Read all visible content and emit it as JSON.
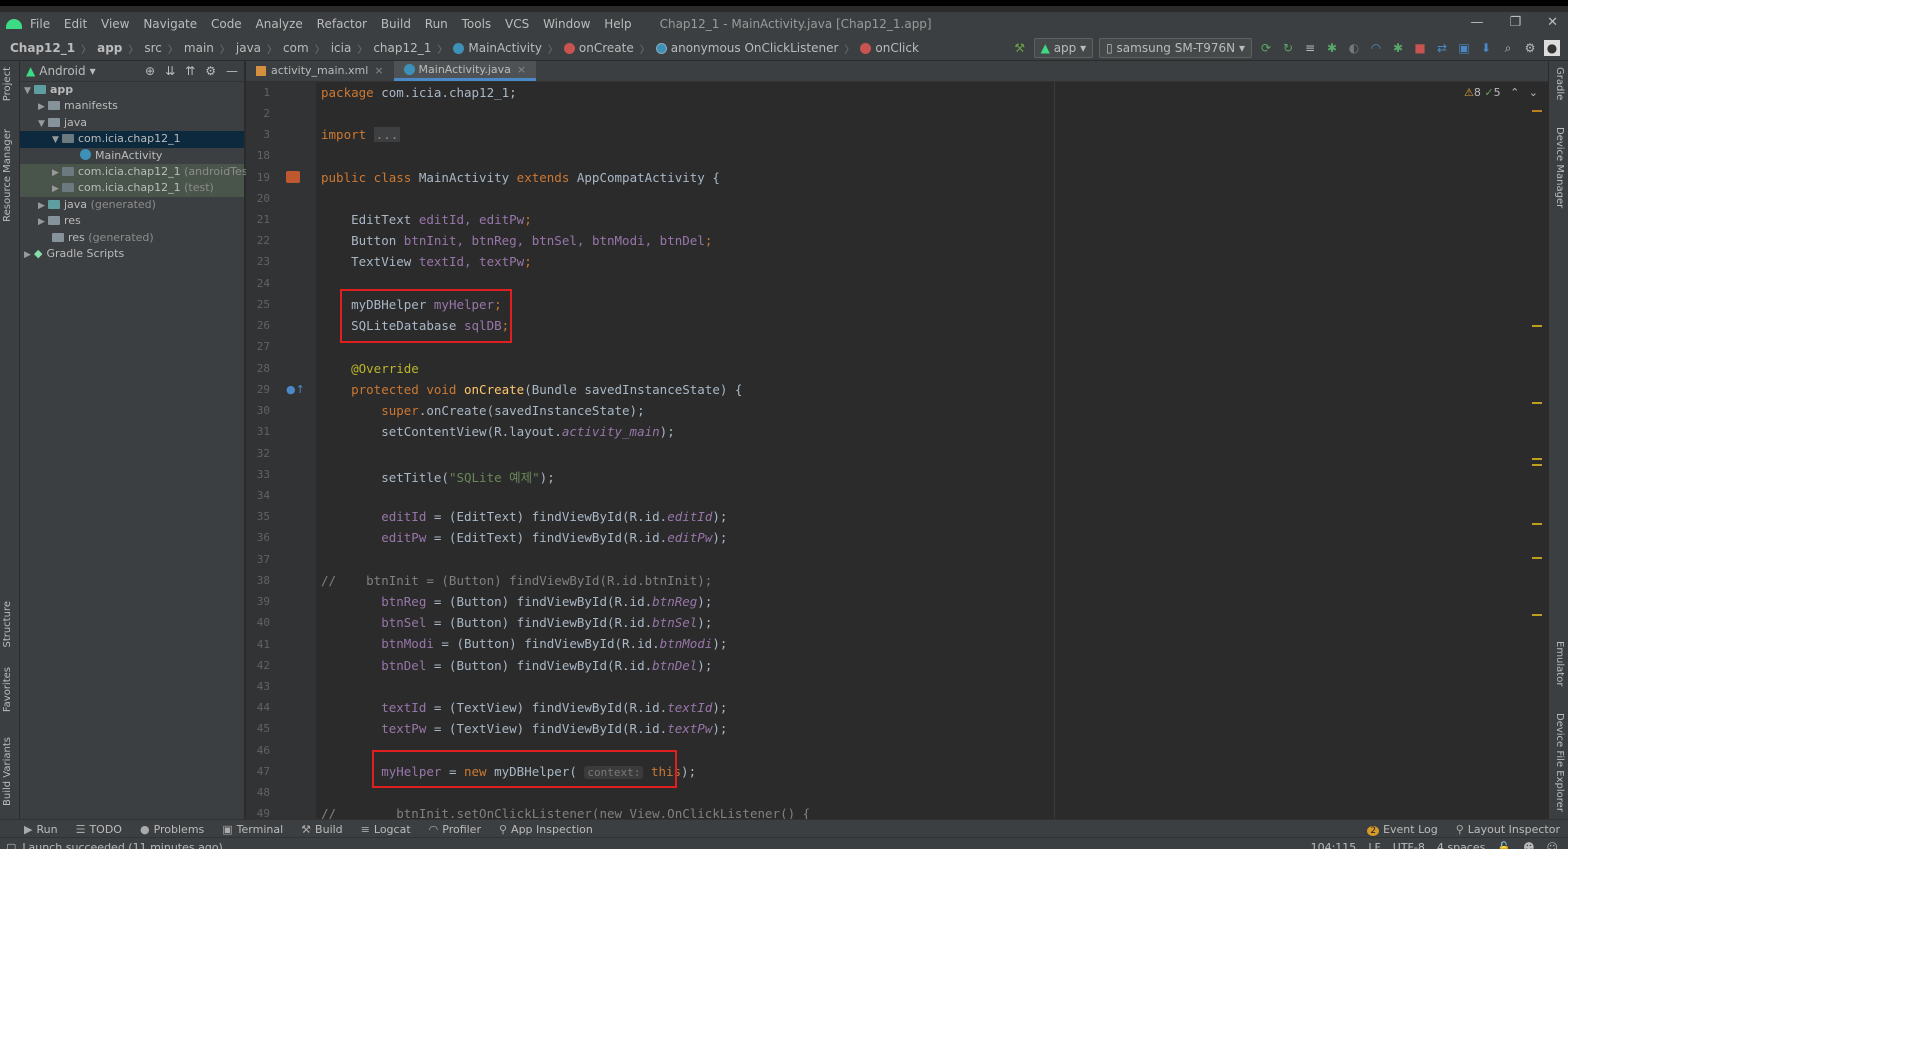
{
  "window": {
    "title": "Chap12_1 - MainActivity.java [Chap12_1.app]",
    "menu": [
      "File",
      "Edit",
      "View",
      "Navigate",
      "Code",
      "Analyze",
      "Refactor",
      "Build",
      "Run",
      "Tools",
      "VCS",
      "Window",
      "Help"
    ]
  },
  "breadcrumb": [
    "Chap12_1",
    "app",
    "src",
    "main",
    "java",
    "com",
    "icia",
    "chap12_1",
    "MainActivity",
    "onCreate",
    "anonymous OnClickListener",
    "onClick"
  ],
  "toolbar": {
    "run_config": "app",
    "device": "samsung SM-T976N"
  },
  "project_pane": {
    "view": "Android",
    "tree": {
      "app": "app",
      "manifests": "manifests",
      "java": "java",
      "pkg_main": "com.icia.chap12_1",
      "main_activity": "MainActivity",
      "pkg_android_test": "com.icia.chap12_1",
      "android_test_suffix": "(androidTest)",
      "pkg_test": "com.icia.chap12_1",
      "test_suffix": "(test)",
      "java_generated": "java",
      "java_generated_suffix": "(generated)",
      "res": "res",
      "res_generated": "res",
      "res_generated_suffix": "(generated)",
      "gradle_scripts": "Gradle Scripts"
    }
  },
  "left_stripe": [
    "Project",
    "Resource Manager",
    "Structure",
    "Favorites",
    "Build Variants"
  ],
  "right_stripe": [
    "Gradle",
    "Device Manager",
    "Emulator",
    "Device File Explorer"
  ],
  "editor_tabs": [
    {
      "label": "activity_main.xml",
      "active": false
    },
    {
      "label": "MainActivity.java",
      "active": true
    }
  ],
  "inspections": {
    "warnings": "8",
    "weak_warnings": "5"
  },
  "code": {
    "line_numbers": [
      "1",
      "2",
      "3",
      "18",
      "19",
      "20",
      "21",
      "22",
      "23",
      "24",
      "25",
      "26",
      "27",
      "28",
      "29",
      "30",
      "31",
      "32",
      "33",
      "34",
      "35",
      "36",
      "37",
      "38",
      "39",
      "40",
      "41",
      "42",
      "43",
      "44",
      "45",
      "46",
      "47",
      "48",
      "49"
    ],
    "l1_pkg": "package",
    "l1_name": " com.icia.chap12_1;",
    "l3_import": "import",
    "l3_dots": "...",
    "l19_public": "public class",
    "l19_name": " MainActivity ",
    "l19_extends": "extends",
    "l19_rest": " AppCompatActivity {",
    "l21_type": "    EditText ",
    "l21_vars": "editId, editPw",
    "l22_type": "    Button ",
    "l22_vars": "btnInit, btnReg, btnSel, btnModi, btnDel",
    "l23_type": "    TextView ",
    "l23_vars": "textId, textPw",
    "l25_type": "    myDBHelper ",
    "l25_var": "myHelper",
    "l26_type": "    SQLiteDatabase ",
    "l26_var": "sqlDB",
    "l28_ann": "    @Override",
    "l29_kw": "    protected void ",
    "l29_mth": "onCreate",
    "l29_rest": "(Bundle savedInstanceState) {",
    "l30_super": "        super",
    "l30_rest": ".onCreate(savedInstanceState);",
    "l31_a": "        setContentView(R.layout.",
    "l31_b": "activity_main",
    "l31_c": ");",
    "l33_a": "        setTitle(",
    "l33_str": "\"SQLite 예제\"",
    "l33_c": ");",
    "l35_var": "        editId",
    "l35_a": " = (EditText) findViewById(R.id.",
    "l35_id": "editId",
    "l36_var": "        editPw",
    "l36_a": " = (EditText) findViewById(R.id.",
    "l36_id": "editPw",
    "l38_cmt": "//    btnInit = (Button) findViewById(R.id.btnInit);",
    "l39_var": "        btnReg",
    "l39_a": " = (Button) findViewById(R.id.",
    "l39_id": "btnReg",
    "l40_var": "        btnSel",
    "l40_a": " = (Button) findViewById(R.id.",
    "l40_id": "btnSel",
    "l41_var": "        btnModi",
    "l41_a": " = (Button) findViewById(R.id.",
    "l41_id": "btnModi",
    "l42_var": "        btnDel",
    "l42_a": " = (Button) findViewById(R.id.",
    "l42_id": "btnDel",
    "l44_var": "        textId",
    "l44_a": " = (TextView) findViewById(R.id.",
    "l44_id": "textId",
    "l45_var": "        textPw",
    "l45_a": " = (TextView) findViewById(R.id.",
    "l45_id": "textPw",
    "l47_var": "        myHelper",
    "l47_new": "new",
    "l47_cls": " myDBHelper(",
    "l47_hint": "context:",
    "l47_this": "this",
    "l49_cmt": "//        btnInit.setOnClickListener(new View.OnClickListener() {"
  },
  "bottom_tools": [
    "Run",
    "TODO",
    "Problems",
    "Terminal",
    "Build",
    "Logcat",
    "Profiler",
    "App Inspection"
  ],
  "bottom_right": [
    "Event Log",
    "Layout Inspector"
  ],
  "event_log_count": "2",
  "status": {
    "message": "Launch succeeded (11 minutes ago)",
    "position": "104:115",
    "line_sep": "LF",
    "encoding": "UTF-8",
    "indent": "4 spaces"
  },
  "colors": {
    "highlight_box": "#e02020",
    "accent": "#4a88c7"
  }
}
